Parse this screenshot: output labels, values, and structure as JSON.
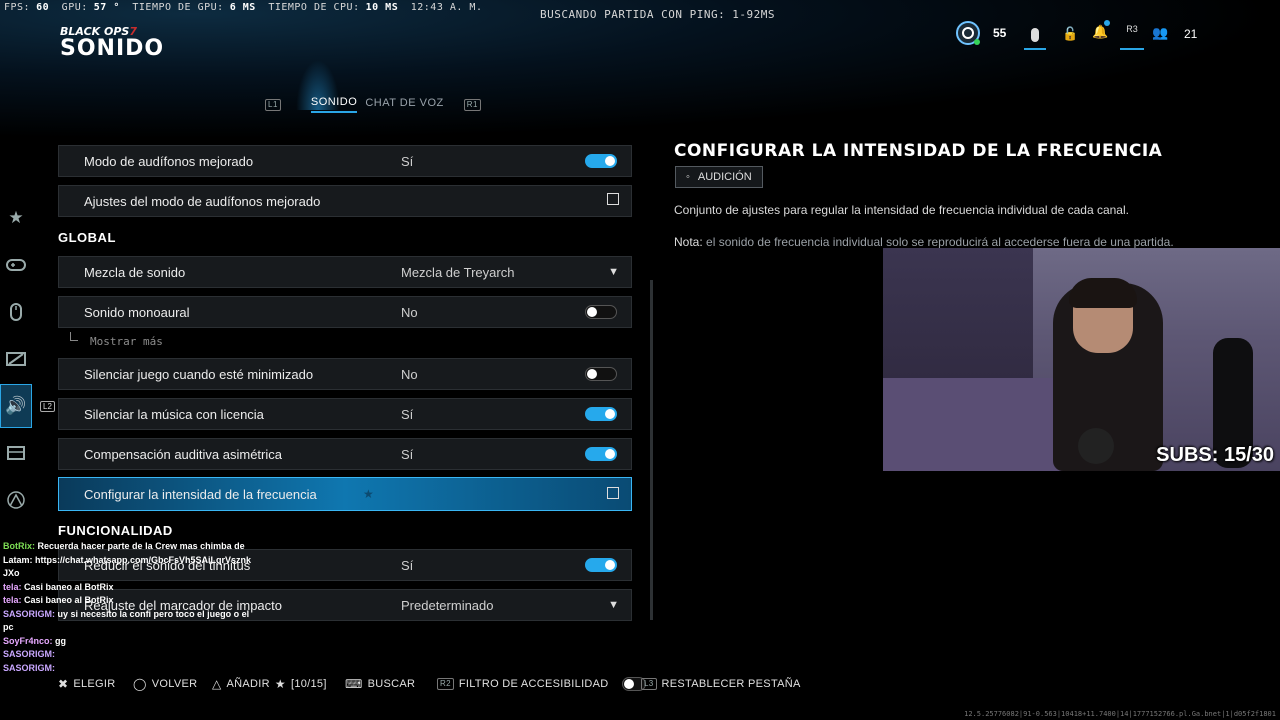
{
  "perf": {
    "fps_label": "FPS:",
    "fps": "60",
    "gpu_label": "GPU:",
    "gpu": "57 °",
    "gpu_time_label": "TIEMPO DE GPU:",
    "gpu_time": "6 MS",
    "cpu_time_label": "TIEMPO DE CPU:",
    "cpu_time": "10 MS",
    "clock": "12:43 A. M."
  },
  "matchmaking": "BUSCANDO PARTIDA CON PING: 1-92MS",
  "brand": {
    "game": "BLACK OPS",
    "num": "7"
  },
  "page_title": "SONIDO",
  "status_bar": {
    "level": "55",
    "r3": "R3",
    "party_count": "21"
  },
  "tabs": {
    "l1": "L1",
    "sound": "SONIDO",
    "voice": "CHAT DE VOZ",
    "r1": "R1"
  },
  "side_nav": [
    "star-icon",
    "gamepad-icon",
    "mouse-icon",
    "display-icon",
    "speaker-icon",
    "layout-icon",
    "network-icon"
  ],
  "settings": {
    "row1": {
      "label": "Modo de audífonos mejorado",
      "value": "Sí",
      "toggle": true
    },
    "row2": {
      "label": "Ajustes del modo de audífonos mejorado"
    },
    "global_header": "GLOBAL",
    "row3": {
      "label": "Mezcla de sonido",
      "value": "Mezcla de Treyarch"
    },
    "row4": {
      "label": "Sonido monoaural",
      "value": "No",
      "toggle": false
    },
    "show_more": "Mostrar más",
    "row5": {
      "label": "Silenciar juego cuando esté minimizado",
      "value": "No",
      "toggle": false
    },
    "row6": {
      "label": "Silenciar la música con licencia",
      "value": "Sí",
      "toggle": true
    },
    "row7": {
      "label": "Compensación auditiva asimétrica",
      "value": "Sí",
      "toggle": true
    },
    "row8": {
      "label": "Configurar la intensidad de la frecuencia"
    },
    "func_header": "FUNCIONALIDAD",
    "row9": {
      "label": "Reducir el sonido del tinnitus",
      "value": "Sí",
      "toggle": true
    },
    "row10": {
      "label": "Reajuste del marcador de impacto",
      "value": "Predeterminado"
    },
    "l2": "L2"
  },
  "detail": {
    "title": "CONFIGURAR LA INTENSIDAD DE LA FRECUENCIA",
    "badge": "AUDICIÓN",
    "description": "Conjunto de ajustes para regular la intensidad de frecuencia individual de cada canal.",
    "note_label": "Nota:",
    "note": "el sonido de frecuencia individual solo se reproducirá al accederse fuera de una partida."
  },
  "webcam": {
    "subs": "SUBS: 15/30"
  },
  "chat": [
    {
      "user": "BotRix:",
      "text": "Recuerda hacer parte de la Crew mas chimba de Latam: https://chat.whatsapp.com/GbcFsVh5SAiLqrVsznk JXo",
      "color": "#7dde55"
    },
    {
      "user": "tela:",
      "text": "Casi baneo al BotRix",
      "color": "#e7a9ff"
    },
    {
      "user": "tela:",
      "text": "Casi baneo al BotRix",
      "color": "#e7a9ff"
    },
    {
      "user": "SASORIGM:",
      "text": "uy si necesito la confi pero toco el juego o el pc",
      "color": "#c9a7ff"
    },
    {
      "user": "SoyFr4nco:",
      "text": "gg",
      "color": "#e7a9ff"
    },
    {
      "user": "SASORIGM:",
      "text": "",
      "color": "#c9a7ff"
    },
    {
      "user": "SASORIGM:",
      "text": "",
      "color": "#c9a7ff"
    }
  ],
  "footer": {
    "choose": "ELEGIR",
    "back": "VOLVER",
    "add": "AÑADIR",
    "fav_count": "[10/15]",
    "search": "BUSCAR",
    "r2": "R2",
    "accessibility": "FILTRO DE ACCESIBILIDAD",
    "l3": "L3",
    "reset": "RESTABLECER PESTAÑA"
  },
  "build": "12.5.25776082|91-0.563|10418+11.7400|14|1777152766.pl.Ga.bnet|1|d05f2f1801"
}
